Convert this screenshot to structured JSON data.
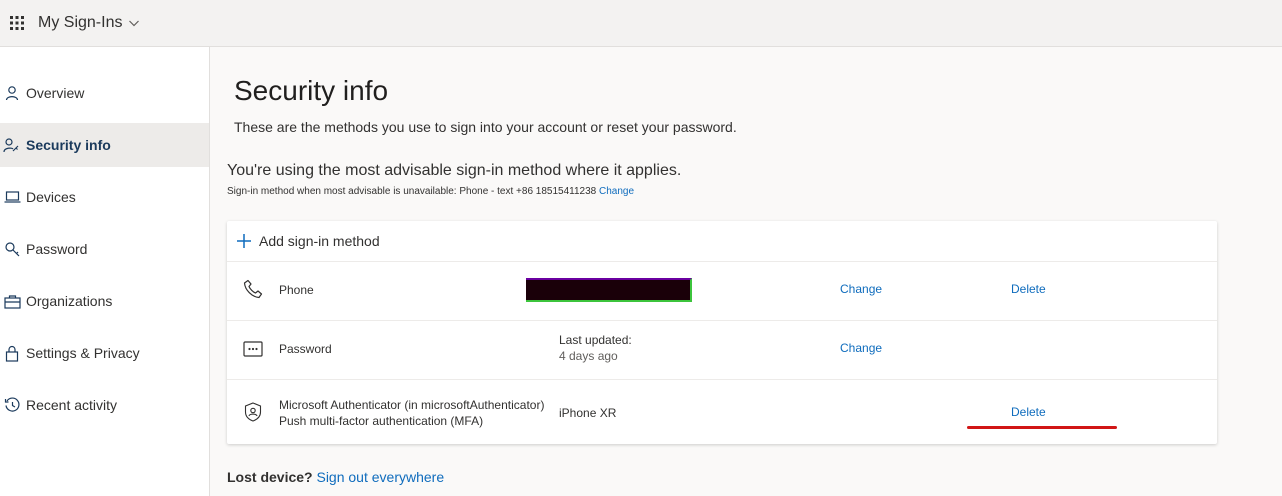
{
  "header": {
    "app_title": "My Sign-Ins"
  },
  "sidebar": {
    "items": [
      {
        "label": "Overview",
        "icon": "person-icon"
      },
      {
        "label": "Security info",
        "icon": "person-key-icon",
        "active": true
      },
      {
        "label": "Devices",
        "icon": "laptop-icon"
      },
      {
        "label": "Password",
        "icon": "key-icon"
      },
      {
        "label": "Organizations",
        "icon": "briefcase-icon"
      },
      {
        "label": "Settings & Privacy",
        "icon": "lock-icon"
      },
      {
        "label": "Recent activity",
        "icon": "history-icon"
      }
    ]
  },
  "main": {
    "title": "Security info",
    "description": "These are the methods you use to sign into your account or reset your password.",
    "advisable": "You're using the most advisable sign-in method where it applies.",
    "fallback_text": "Sign-in method when most advisable is unavailable: Phone - text +86 18515411238",
    "fallback_change": "Change",
    "add_method": "Add sign-in method",
    "methods": [
      {
        "name": "Phone",
        "icon": "phone-icon",
        "change": "Change",
        "delete": "Delete"
      },
      {
        "name": "Password",
        "icon": "password-dots-icon",
        "detail_label": "Last updated:",
        "detail_value": "4 days ago",
        "change": "Change"
      },
      {
        "name_line1": "Microsoft Authenticator (in microsoftAuthenticator)",
        "name_line2": "Push multi-factor authentication (MFA)",
        "icon": "authenticator-icon",
        "detail": "iPhone XR",
        "delete": "Delete"
      }
    ],
    "lost_device_q": "Lost device?",
    "sign_out_link": "Sign out everywhere"
  },
  "colors": {
    "accent": "#0f6cbd",
    "annotation": "#d11616"
  }
}
